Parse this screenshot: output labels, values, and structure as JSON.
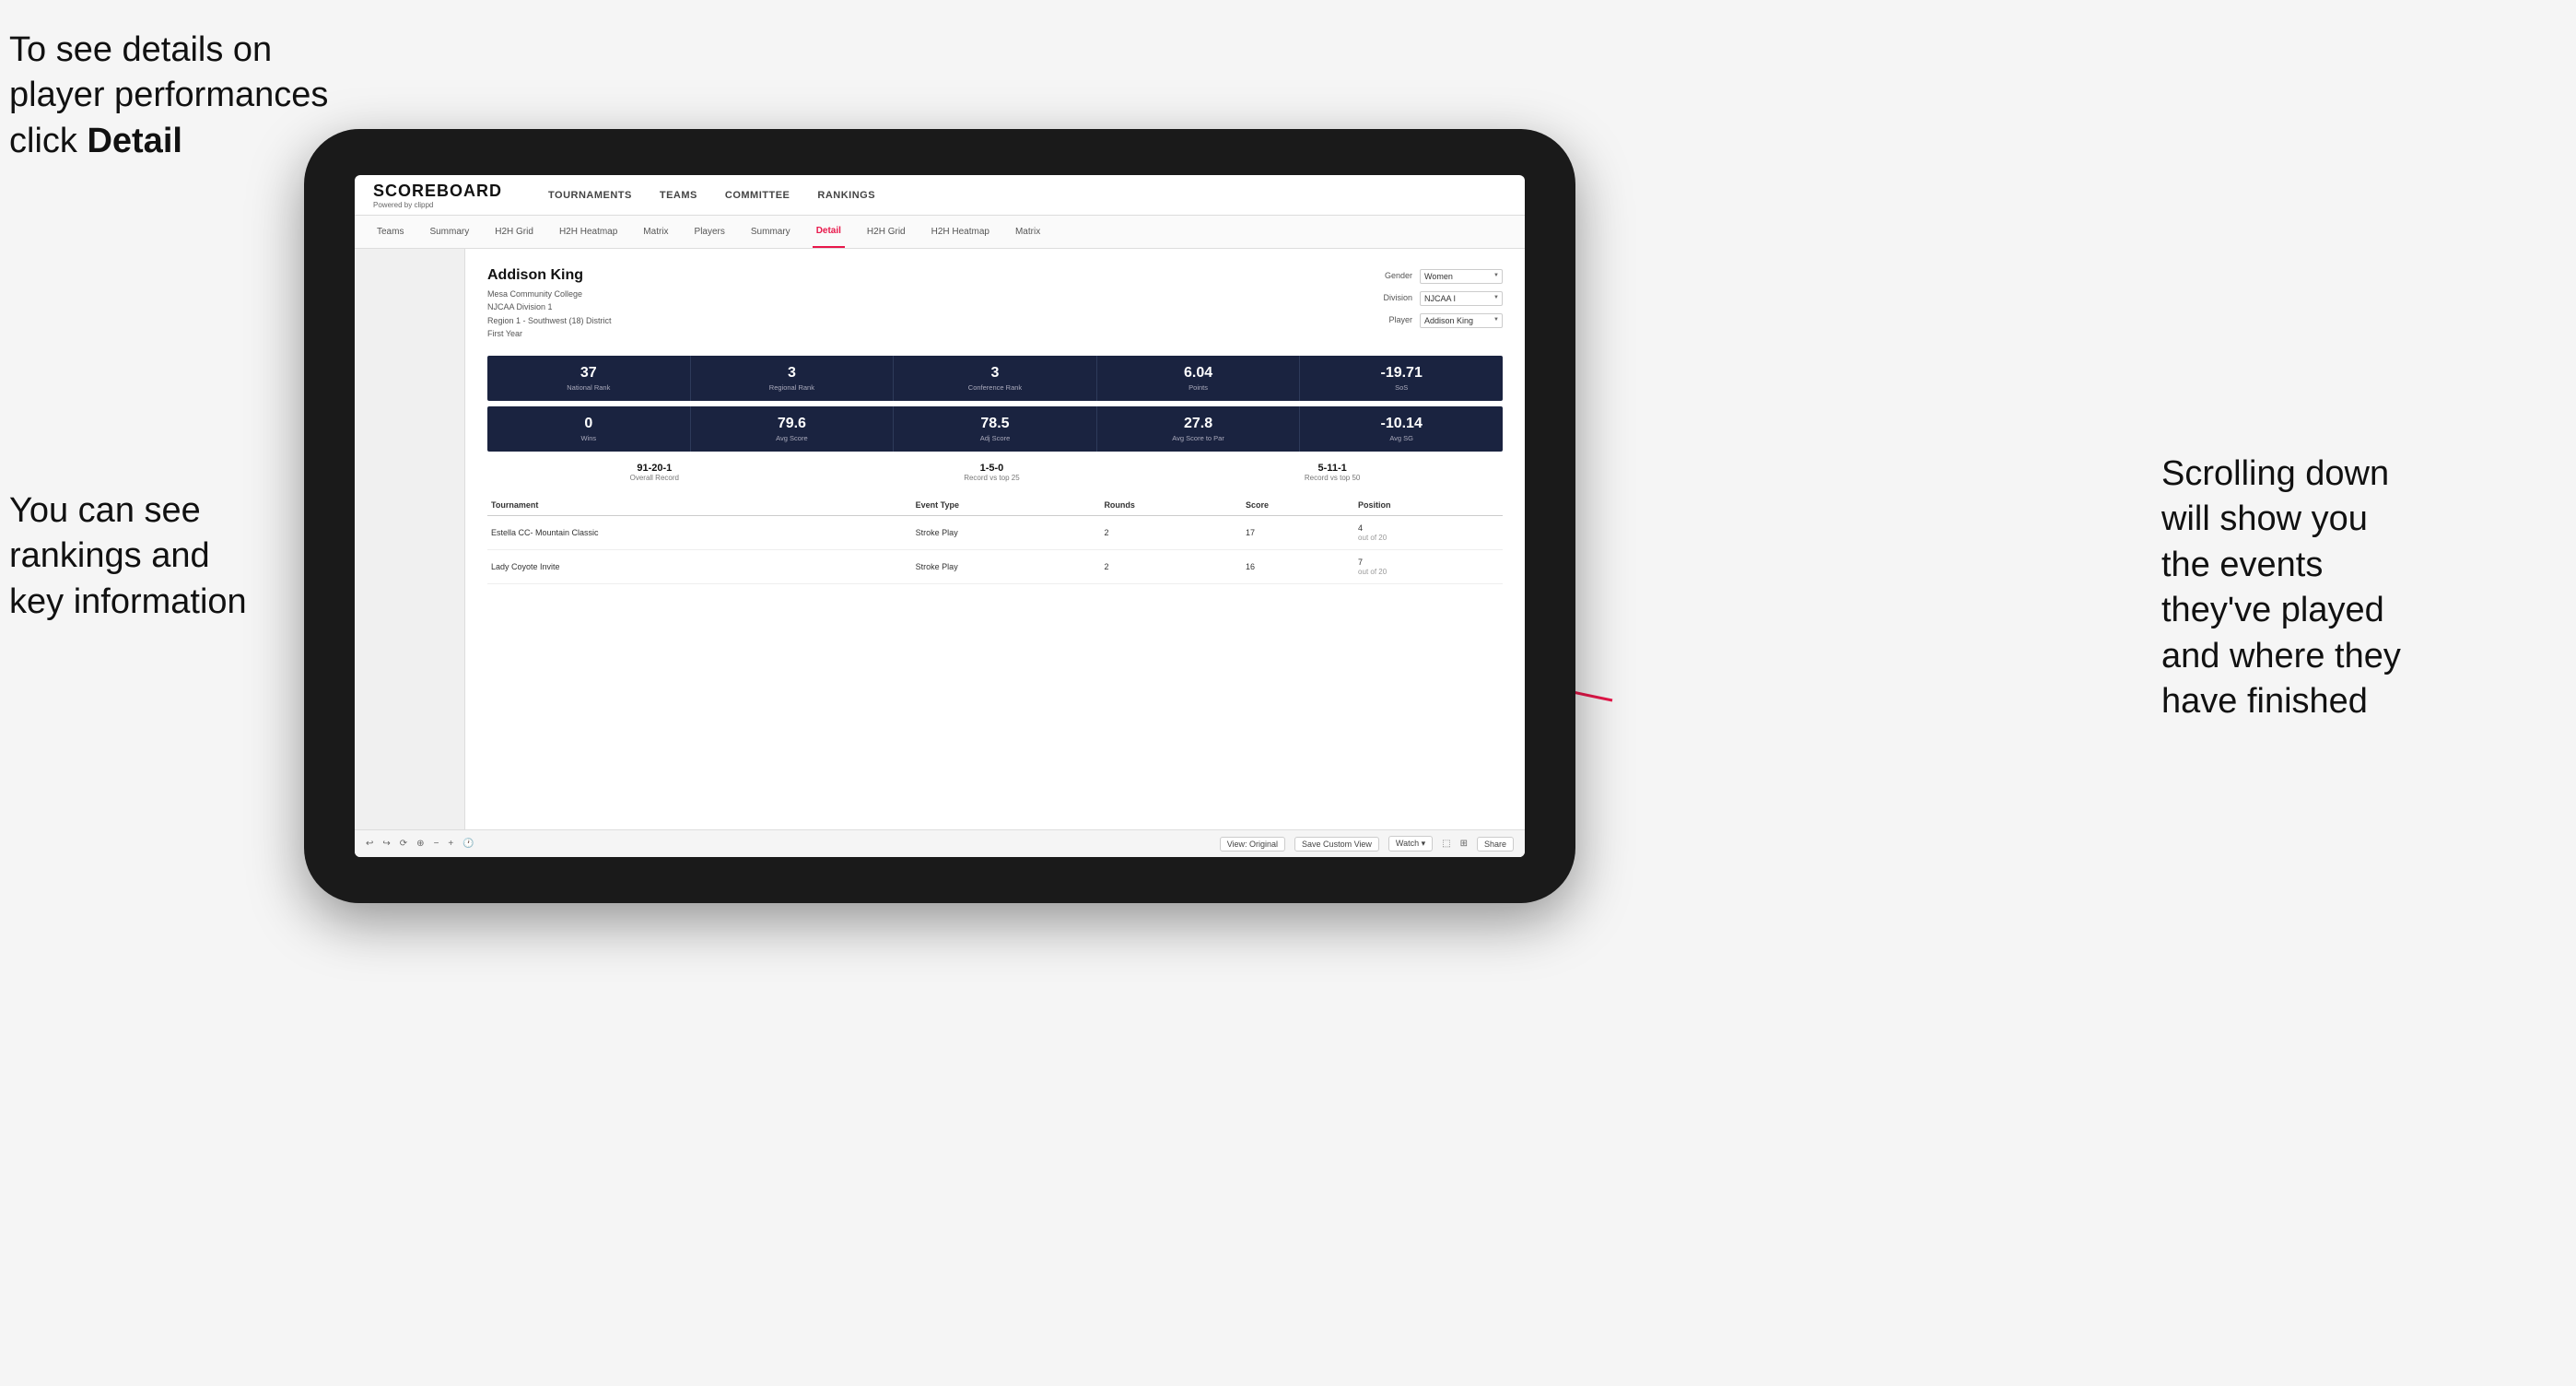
{
  "annotations": {
    "top_left_line1": "To see details on",
    "top_left_line2": "player performances",
    "top_left_line3_prefix": "click ",
    "top_left_line3_bold": "Detail",
    "bottom_left_line1": "You can see",
    "bottom_left_line2": "rankings and",
    "bottom_left_line3": "key information",
    "right_line1": "Scrolling down",
    "right_line2": "will show you",
    "right_line3": "the events",
    "right_line4": "they've played",
    "right_line5": "and where they",
    "right_line6": "have finished"
  },
  "nav": {
    "logo": "SCOREBOARD",
    "logo_sub": "Powered by clippd",
    "items": [
      "TOURNAMENTS",
      "TEAMS",
      "COMMITTEE",
      "RANKINGS"
    ]
  },
  "second_nav": {
    "items": [
      "Teams",
      "Summary",
      "H2H Grid",
      "H2H Heatmap",
      "Matrix",
      "Players",
      "Summary",
      "Detail",
      "H2H Grid",
      "H2H Heatmap",
      "Matrix"
    ],
    "active_index": 7
  },
  "player": {
    "name": "Addison King",
    "school": "Mesa Community College",
    "division": "NJCAA Division 1",
    "region": "Region 1 - Southwest (18) District",
    "year": "First Year"
  },
  "filters": {
    "gender_label": "Gender",
    "gender_value": "Women",
    "division_label": "Division",
    "division_value": "NJCAA I",
    "player_label": "Player",
    "player_value": "Addison King"
  },
  "stats_row1": [
    {
      "value": "37",
      "label": "National Rank"
    },
    {
      "value": "3",
      "label": "Regional Rank"
    },
    {
      "value": "3",
      "label": "Conference Rank"
    },
    {
      "value": "6.04",
      "label": "Points"
    },
    {
      "value": "-19.71",
      "label": "SoS"
    }
  ],
  "stats_row2": [
    {
      "value": "0",
      "label": "Wins"
    },
    {
      "value": "79.6",
      "label": "Avg Score"
    },
    {
      "value": "78.5",
      "label": "Adj Score"
    },
    {
      "value": "27.8",
      "label": "Avg Score to Par"
    },
    {
      "value": "-10.14",
      "label": "Avg SG"
    }
  ],
  "records": [
    {
      "value": "91-20-1",
      "label": "Overall Record"
    },
    {
      "value": "1-5-0",
      "label": "Record vs top 25"
    },
    {
      "value": "5-11-1",
      "label": "Record vs top 50"
    }
  ],
  "table": {
    "headers": [
      "Tournament",
      "",
      "Event Type",
      "Rounds",
      "Score",
      "Position"
    ],
    "rows": [
      {
        "tournament": "Estella CC- Mountain Classic",
        "event_type": "Stroke Play",
        "rounds": "2",
        "score": "17",
        "position": "4",
        "position_sub": "out of 20"
      },
      {
        "tournament": "Lady Coyote Invite",
        "event_type": "Stroke Play",
        "rounds": "2",
        "score": "16",
        "position": "7",
        "position_sub": "out of 20"
      }
    ]
  },
  "toolbar": {
    "view_label": "View: Original",
    "save_label": "Save Custom View",
    "watch_label": "Watch ▾",
    "share_label": "Share"
  }
}
